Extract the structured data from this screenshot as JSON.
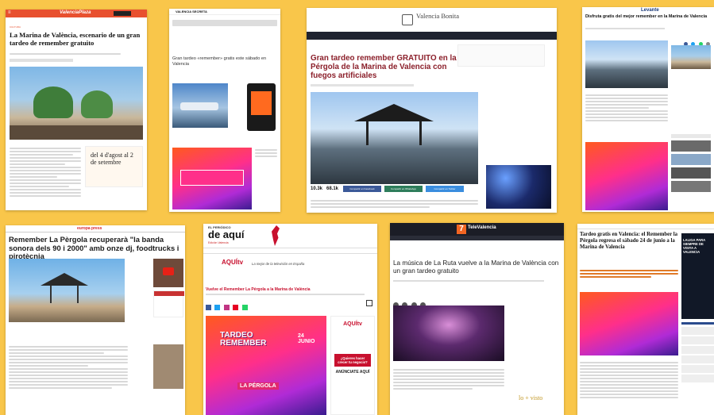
{
  "cards": {
    "valenciaplaza": {
      "brand": "ValenciaPlaza",
      "title": "La Marina de València, escenario de un gran tardeo de remember gratuito",
      "poster_text": "del 4 d'agost al 2 de setembre"
    },
    "valenciasecreta": {
      "brand": "VALENCIA SECRETA",
      "title": "Gran tardeo «remember» gratis este sábado en Valencia"
    },
    "valenciabonita": {
      "brand": "Valencia Bonita",
      "title": "Gran tardeo remember GRATUITO en la Pérgola de la Marina de Valencia con fuegos artificiales",
      "share_count_a": "10.3k",
      "share_count_b": "68.1k",
      "share_facebook": "Compartir en Facebook",
      "share_whatsapp": "Compartir en WhatsApp",
      "share_twitter": "Compartir en Twitter"
    },
    "levante": {
      "brand": "Levante",
      "title": "Disfruta gratis del mejor remember en la Marina de Valencia"
    },
    "europapress": {
      "brand": "europa press",
      "title": "Remember La Pèrgola recuperarà \"la banda sonora dels 90 i 2000\" amb onze dj, foodtrucks i pirotècnia"
    },
    "elperiodicodeaqui": {
      "brand_top": "EL PERIÓDICO",
      "brand_main": "de aquí",
      "brand_sub": "Edición Valencia",
      "aquitv": "AQUÍtv",
      "aquitv_tagline": "La mejor de la televisión en España",
      "title": "Vuelve el Remember La Pérgola a la Marina de València",
      "promo_title": "TARDEO REMEMBER",
      "promo_sub": "LA PÉRGOLA",
      "promo_date": "24 JUNIO",
      "side_ad": "¿Quieres hacer crecer tu negocio?",
      "side_ad_cta": "ANÚNCIATE AQUÍ"
    },
    "televalencia": {
      "brand": "TeleValencia",
      "title": "La música de La Ruta vuelve a la Marina de València con un gran tardeo gratuito",
      "masvisto": "lo + visto"
    },
    "lasprovincias": {
      "title": "Tardeo gratis en Valencia: el Remember la Pérgola regresa el sábado 24 de junio a la Marina de Valencia",
      "side_ad": "LALIGA PARA SIEMPRE DE VISITA A VALENCIA"
    }
  }
}
